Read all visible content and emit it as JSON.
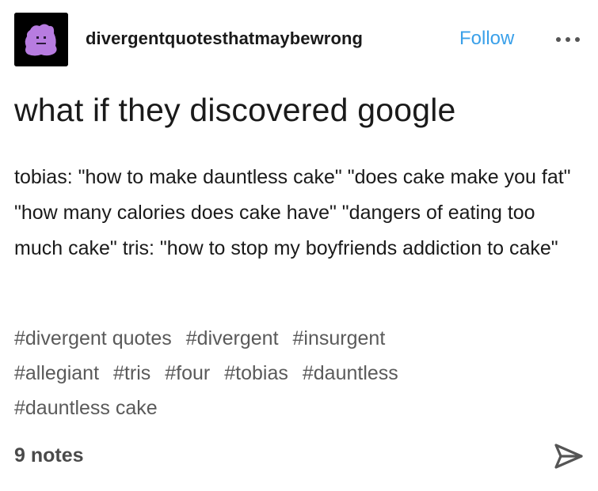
{
  "header": {
    "blog_name": "divergentquotesthatmaybewrong",
    "follow_label": "Follow"
  },
  "post": {
    "title": "what if they discovered google",
    "body": "tobias: \"how to make dauntless cake\" \"does cake make you fat\" \"how many calories does cake have\" \"dangers of eating too much cake\" tris: \"how to stop my boyfriends addiction to cake\"",
    "tags": [
      "#divergent quotes",
      "#divergent",
      "#insurgent",
      "#allegiant",
      "#tris",
      "#four",
      "#tobias",
      "#dauntless",
      "#dauntless cake"
    ],
    "notes": "9 notes"
  },
  "colors": {
    "accent": "#3aa0e9",
    "text": "#1a1a1a",
    "tag_text": "#5a5a5a",
    "avatar_bg": "#000000",
    "avatar_blob": "#b77ce0"
  },
  "icons": {
    "avatar": "ditto-pixel-avatar",
    "more": "ellipsis-icon",
    "share": "share-arrow-icon"
  }
}
